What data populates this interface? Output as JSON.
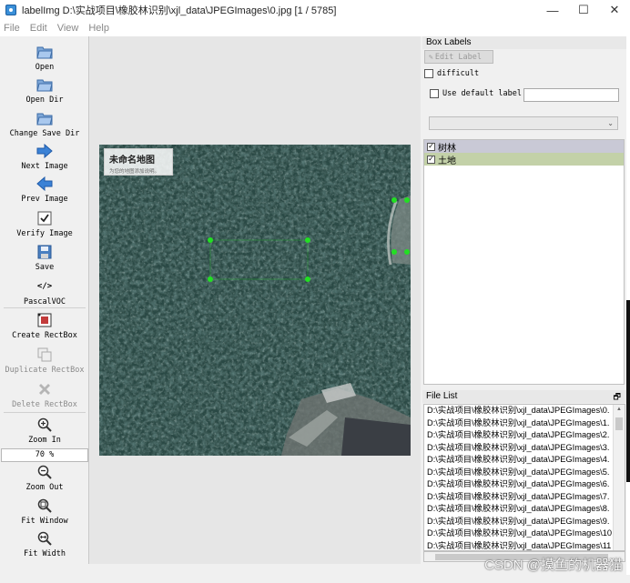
{
  "window": {
    "title": "labelImg D:\\实战项目\\橡胶林识别\\xjl_data\\JPEGImages\\0.jpg [1 / 5785]",
    "controls": {
      "minimize": "—",
      "maximize": "☐",
      "close": "✕"
    }
  },
  "menu": [
    "File",
    "Edit",
    "View",
    "Help"
  ],
  "toolbar": {
    "open": "Open",
    "open_dir": "Open Dir",
    "change_save_dir": "Change Save Dir",
    "next_image": "Next Image",
    "prev_image": "Prev Image",
    "verify_image": "Verify Image",
    "save": "Save",
    "format_icon": "</>",
    "format": "PascalVOC",
    "create_rectbox": "Create RectBox",
    "duplicate_rectbox": "Duplicate RectBox",
    "delete_rectbox": "Delete RectBox",
    "zoom_in": "Zoom In",
    "zoom_value": "70 %",
    "zoom_out": "Zoom Out",
    "fit_window": "Fit Window",
    "fit_width": "Fit Width"
  },
  "map_note": {
    "title": "未命名地图",
    "subtitle": "为您的地图添加说明。"
  },
  "box_labels": {
    "title": "Box Labels",
    "edit_label": "Edit Label",
    "difficult": "difficult",
    "use_default_label": "Use default label",
    "default_label_value": "",
    "combo_value": "",
    "labels": [
      {
        "text": "树林",
        "checked": true,
        "color": "#c9c9d6"
      },
      {
        "text": "土地",
        "checked": true,
        "color": "#c3d1a8"
      }
    ]
  },
  "file_list": {
    "title": "File List",
    "float_icon": "🗗",
    "items": [
      "D:\\实战项目\\橡胶林识别\\xjl_data\\JPEGImages\\0.",
      "D:\\实战项目\\橡胶林识别\\xjl_data\\JPEGImages\\1.",
      "D:\\实战项目\\橡胶林识别\\xjl_data\\JPEGImages\\2.",
      "D:\\实战项目\\橡胶林识别\\xjl_data\\JPEGImages\\3.",
      "D:\\实战项目\\橡胶林识别\\xjl_data\\JPEGImages\\4.",
      "D:\\实战项目\\橡胶林识别\\xjl_data\\JPEGImages\\5.",
      "D:\\实战项目\\橡胶林识别\\xjl_data\\JPEGImages\\6.",
      "D:\\实战项目\\橡胶林识别\\xjl_data\\JPEGImages\\7.",
      "D:\\实战项目\\橡胶林识别\\xjl_data\\JPEGImages\\8.",
      "D:\\实战项目\\橡胶林识别\\xjl_data\\JPEGImages\\9.",
      "D:\\实战项目\\橡胶林识别\\xjl_data\\JPEGImages\\10",
      "D:\\实战项目\\橡胶林识别\\xjl_data\\JPEGImages\\11"
    ]
  },
  "watermark": "CSDN @摸鱼的机器猫",
  "colors": {
    "handle": "#22e022",
    "forest_dark": "#1b332f",
    "forest_light": "#4a6b66"
  }
}
